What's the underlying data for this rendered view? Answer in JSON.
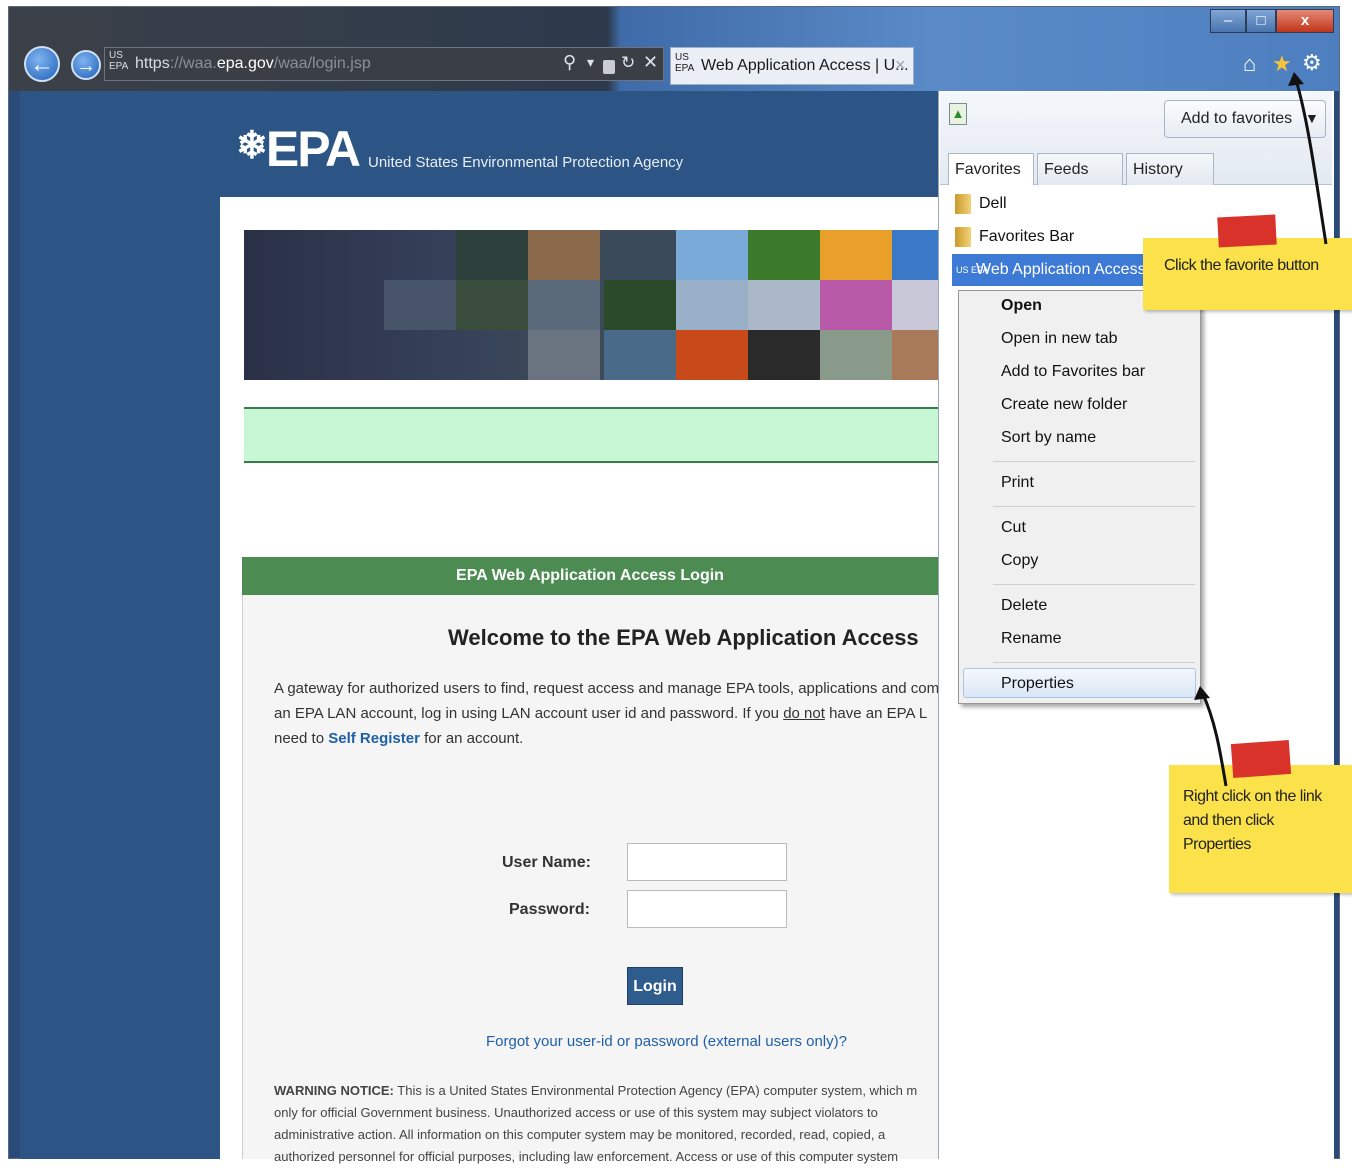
{
  "browser": {
    "address": {
      "favicon": "US EPA",
      "scheme": "https",
      "host_prefix": "://waa.",
      "host": "epa.gov",
      "path": "/waa/login.jsp"
    },
    "address_icons": [
      "search-icon",
      "lock-icon",
      "refresh-icon",
      "stop-icon"
    ],
    "tab": {
      "favicon": "US EPA",
      "title": "Web Application Access | U...",
      "close": "×"
    },
    "window_controls": {
      "minimize": "–",
      "maximize": "□",
      "close": "x"
    },
    "toolbar_icons": [
      "home-icon",
      "favorites-star-icon",
      "gear-icon"
    ]
  },
  "epa": {
    "logo": "EPA",
    "agency": "United States Environmental Protection Agency",
    "login_header": "EPA Web Application Access Login",
    "welcome": "Welcome to the EPA Web Application Access",
    "intro_line1": "A gateway for authorized users to find, request access and manage EPA tools, applications and com",
    "intro_line2_a": "an EPA LAN account, log in using LAN account user id and password. If you ",
    "intro_line2_underline": "do not",
    "intro_line2_b": " have an EPA L",
    "intro_line3_a": "need to ",
    "intro_line3_link": "Self Register",
    "intro_line3_b": " for an account.",
    "username_label": "User Name:",
    "password_label": "Password:",
    "login_button": "Login",
    "forgot_link": "Forgot your user-id or password (external users only)?",
    "warning_bold": "WARNING NOTICE:",
    "warning_line1": " This is a United States Environmental Protection Agency (EPA) computer system, which m",
    "warning_line2": "only for official Government business. Unauthorized access or use of this system may subject violators to",
    "warning_line3": "administrative action. All information on this computer system may be monitored, recorded, read, copied, a",
    "warning_line4": "authorized personnel for official purposes, including law enforcement. Access or use of this computer system"
  },
  "favorites": {
    "add_button": "Add to favorites",
    "tabs": [
      "Favorites",
      "Feeds",
      "History"
    ],
    "items": [
      {
        "label": "Dell",
        "icon": "folder-icon"
      },
      {
        "label": "Favorites Bar",
        "icon": "folder-icon"
      },
      {
        "label": "Web Application Access",
        "icon": "US EPA"
      }
    ]
  },
  "context_menu": {
    "groups": [
      [
        "Open",
        "Open in new tab",
        "Add to Favorites bar",
        "Create new folder",
        "Sort by name"
      ],
      [
        "Print"
      ],
      [
        "Cut",
        "Copy"
      ],
      [
        "Delete",
        "Rename"
      ],
      [
        "Properties"
      ]
    ]
  },
  "notes": {
    "note1": "Click the favorite button",
    "note2_line1": "Right click on the link",
    "note2_line2": "and then click",
    "note2_line3": "Properties"
  },
  "colors": {
    "page_blue": "#2c5484",
    "login_green": "#4c8c52",
    "highlight_blue": "#3d7ad6",
    "note_yellow": "#fbe24b",
    "tape_red": "#d9322b"
  }
}
